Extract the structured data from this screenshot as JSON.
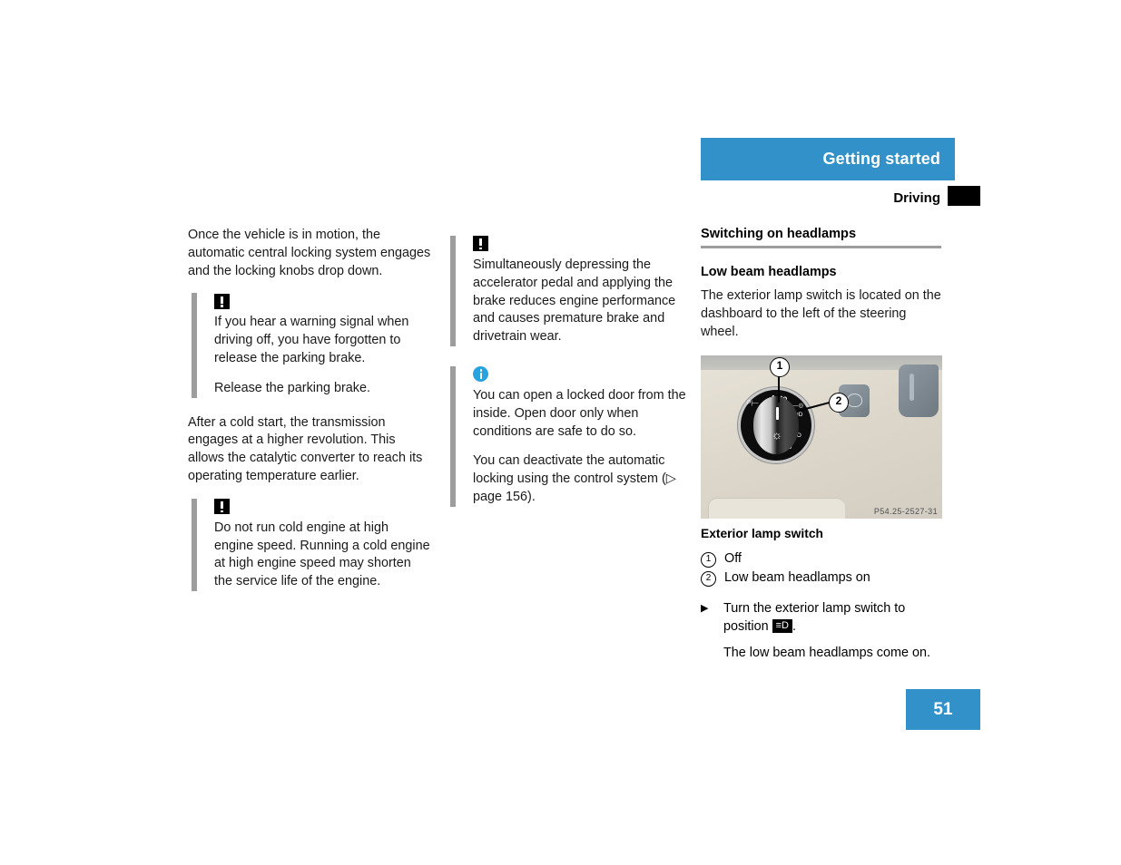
{
  "header": {
    "title": "Getting started",
    "subtitle": "Driving",
    "accent_color": "#3191c8",
    "tab_color": "#000000"
  },
  "left_column": {
    "intro": "Once the vehicle is in motion, the automatic central locking system engages and the locking knobs drop down.",
    "note1": {
      "icon": "warning-icon",
      "lines": [
        "If you hear a warning signal when driving off, you have forgotten to release the parking brake.",
        "Release the parking brake."
      ]
    },
    "para2": "After a cold start, the transmission engages at a higher revolution. This allows the catalytic converter to reach its operating temperature earlier.",
    "note2": {
      "icon": "warning-icon",
      "lines": [
        "Do not run cold engine at high engine speed. Running a cold engine at high engine speed may shorten the service life of the engine."
      ]
    }
  },
  "middle_column": {
    "note1": {
      "icon": "warning-icon",
      "lines": [
        "Simultaneously depressing the accelerator pedal and applying the brake reduces engine performance and causes premature brake and drivetrain wear."
      ]
    },
    "note2": {
      "icon": "info-icon",
      "lines": [
        "You can open a locked door from the inside. Open door only when conditions are safe to do so.",
        "You can deactivate the automatic locking using the control system (▷ page 156)."
      ]
    }
  },
  "right_column": {
    "section_heading": "Switching on headlamps",
    "sub_heading": "Low beam headlamps",
    "body": "The exterior lamp switch is located on the dashboard to the left of the steering wheel.",
    "figure": {
      "code": "P54.25-2527-31",
      "callouts": [
        "1",
        "2"
      ],
      "dial_labels": [
        "Auto"
      ],
      "alt": "exterior-lamp-switch-photo"
    },
    "figure_caption": "Exterior lamp switch",
    "legend": [
      {
        "num": "1",
        "text": "Off"
      },
      {
        "num": "2",
        "text": "Low beam headlamps on"
      }
    ],
    "step": {
      "arrow": "▶",
      "text_before": "Turn the exterior lamp switch to position",
      "symbol": "low-beam-symbol",
      "text_after": "."
    },
    "result": "The low beam headlamps come on."
  },
  "page": {
    "number": "51"
  }
}
